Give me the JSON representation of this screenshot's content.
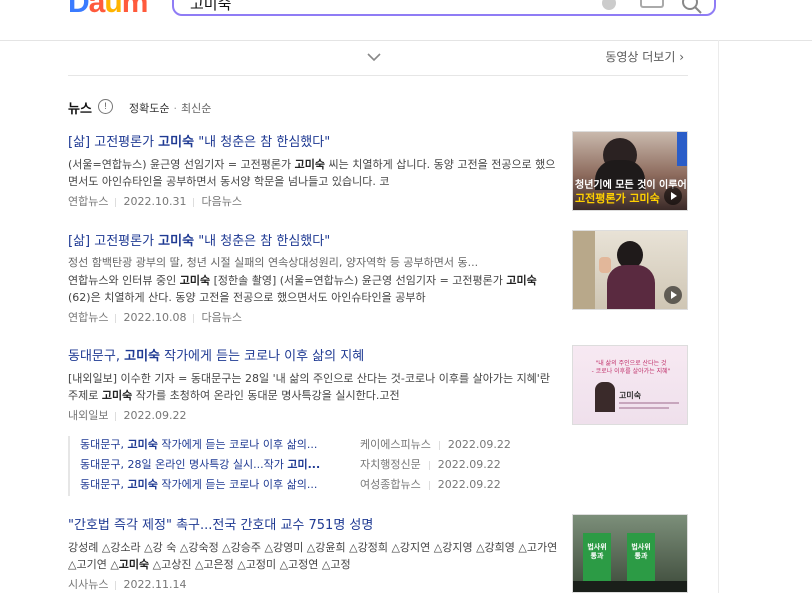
{
  "header": {
    "logo_text": [
      "D",
      "a",
      "u",
      "m"
    ],
    "search_value": "고미숙"
  },
  "more": {
    "label": "동영상 더보기 ›"
  },
  "section": {
    "title": "뉴스",
    "info": "!",
    "sort_active": "정확도순",
    "sort_inactive": "최신순"
  },
  "news": [
    {
      "title_pre": "[삶] 고전평론가 ",
      "title_bold": "고미숙",
      "title_post": " \"내 청춘은 참 한심했다\"",
      "desc_parts": [
        "(서울=연합뉴스) 윤근영 선임기자 = 고전평론가 ",
        "고미숙",
        " 씨는 치열하게 삽니다. 동양 고전을 전공으로 했으면서도 아인슈타인을 공부하면서 동서양 학문을 넘나들고 있습니다. 코"
      ],
      "source": "연합뉴스",
      "date": "2022.10.31",
      "via": "다음뉴스"
    },
    {
      "title_pre": "[삶] 고전평론가 ",
      "title_bold": "고미숙",
      "title_post": " \"내 청춘은 참 한심했다\"",
      "subline": "정선 함백탄광 광부의 딸, 청년 시절 실패의 연속상대성원리, 양자역학 등 공부하면서 동...",
      "desc_parts": [
        "연합뉴스와 인터뷰 중인 ",
        "고미숙",
        " [정한솔 촬영] (서울=연합뉴스) 윤근영 선임기자 = 고전평론가 ",
        "고미숙",
        "(62)은 치열하게 산다. 동양 고전을 전공으로 했으면서도 아인슈타인을 공부하"
      ],
      "source": "연합뉴스",
      "date": "2022.10.08",
      "via": "다음뉴스"
    },
    {
      "title_pre": "동대문구, ",
      "title_bold": "고미숙",
      "title_post": " 작가에게 듣는 코로나 이후 삶의 지혜",
      "desc_parts": [
        "[내외일보] 이수한 기자 = 동대문구는 28일 '내 삶의 주인으로 산다는 것-코로나 이후를 살아가는 지혜'란 주제로 ",
        "고미숙",
        " 작가를 초청하여 온라인 동대문 명사특강을 실시한다.고전"
      ],
      "source": "내외일보",
      "date": "2022.09.22"
    },
    {
      "title": "\"간호법 즉각 제정\" 촉구...전국 간호대 교수 751명 성명",
      "desc_parts": [
        "강성례 △강소라 △강 숙 △강숙정 △강승주 △강영미 △강윤희 △강정희 △강지연 △강지영 △강희영 △고가연 △고기연 △",
        "고미숙",
        " △고상진 △고은정 △고정미 △고정연 △고정"
      ],
      "source": "시사뉴스",
      "date": "2022.11.14"
    }
  ],
  "related": [
    {
      "pre": "동대문구, ",
      "bold": "고미숙",
      "post": " 작가에게 듣는 코로나 이후 삶의...",
      "source": "케이에스피뉴스",
      "date": "2022.09.22"
    },
    {
      "pre": "동대문구, 28일 온라인 명사특강 실시...작가 ",
      "bold": "고미...",
      "post": "",
      "source": "자치행정신문",
      "date": "2022.09.22"
    },
    {
      "pre": "동대문구, ",
      "bold": "고미숙",
      "post": " 작가에게 듣는 코로나 이후 삶의...",
      "source": "여성종합뉴스",
      "date": "2022.09.22"
    }
  ],
  "thumbs": {
    "t1_overlay": "고전평론가 고미숙",
    "t1_overlay_top": "청년기에 모든 것이 이루어진",
    "t3_title": "고미숙",
    "t3_lines": [
      "\"내 삶의 주인으로 산다는 것",
      "- 코로나 이후를 살아가는 지혜\""
    ],
    "t4_sign1": "법사위 통과",
    "t4_sign2": "법사위 통과"
  },
  "colors": {
    "accent": "#8f7cf5",
    "link": "#1f3a93"
  }
}
